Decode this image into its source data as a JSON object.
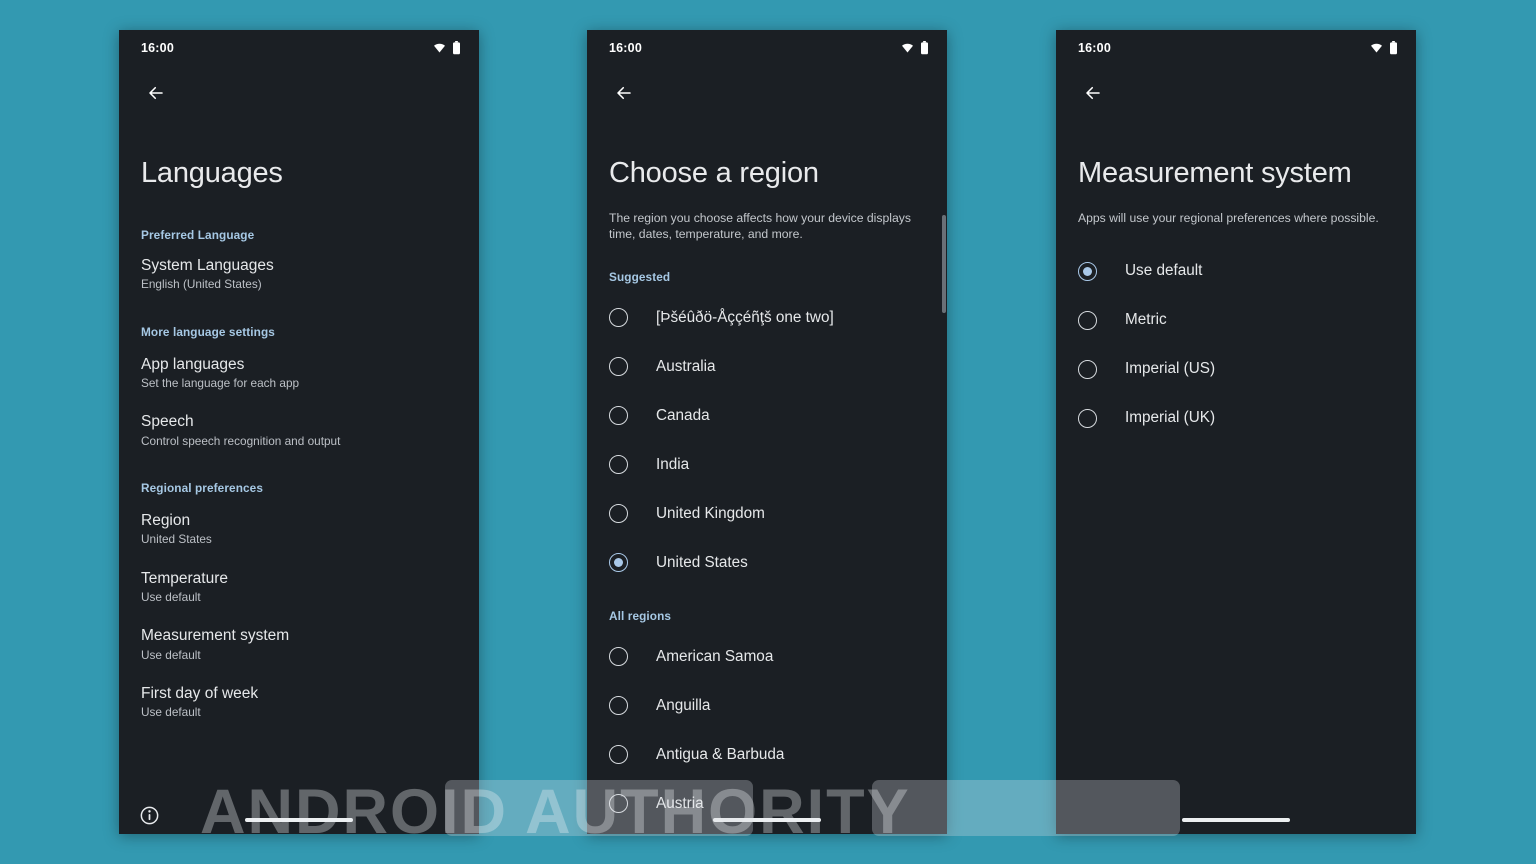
{
  "background_color": "#3399b1",
  "accent_color": "#a9c8e8",
  "section_header_color": "#a6c8e4",
  "status_bar": {
    "time": "16:00",
    "wifi_icon": "wifi-icon",
    "battery_icon": "battery-icon"
  },
  "watermark": {
    "text": "ANDROID AUTHORITY"
  },
  "phones": [
    {
      "id": "languages",
      "title": "Languages",
      "back_icon": "back-arrow-icon",
      "info_icon": "info-icon",
      "sections": [
        {
          "header": "Preferred Language",
          "items": [
            {
              "title": "System Languages",
              "subtitle": "English (United States)"
            }
          ]
        },
        {
          "header": "More language settings",
          "items": [
            {
              "title": "App languages",
              "subtitle": "Set the language for each app"
            },
            {
              "title": "Speech",
              "subtitle": "Control speech recognition and output"
            }
          ]
        },
        {
          "header": "Regional preferences",
          "items": [
            {
              "title": "Region",
              "subtitle": "United States"
            },
            {
              "title": "Temperature",
              "subtitle": "Use default"
            },
            {
              "title": "Measurement system",
              "subtitle": "Use default"
            },
            {
              "title": "First day of week",
              "subtitle": "Use default"
            }
          ]
        }
      ]
    },
    {
      "id": "choose-a-region",
      "title": "Choose a region",
      "back_icon": "back-arrow-icon",
      "description": "The region you choose affects how your device displays time, dates, temperature, and more.",
      "groups": [
        {
          "header": "Suggested",
          "options": [
            {
              "label": "[Þšéûðö-Åççéñţš one two]",
              "selected": false
            },
            {
              "label": "Australia",
              "selected": false
            },
            {
              "label": "Canada",
              "selected": false
            },
            {
              "label": "India",
              "selected": false
            },
            {
              "label": "United Kingdom",
              "selected": false
            },
            {
              "label": "United States",
              "selected": true
            }
          ]
        },
        {
          "header": "All regions",
          "options": [
            {
              "label": "American Samoa",
              "selected": false
            },
            {
              "label": "Anguilla",
              "selected": false
            },
            {
              "label": "Antigua & Barbuda",
              "selected": false
            },
            {
              "label": "Austria",
              "selected": false
            }
          ]
        }
      ]
    },
    {
      "id": "measurement-system",
      "title": "Measurement system",
      "back_icon": "back-arrow-icon",
      "description": "Apps will use your regional preferences where possible.",
      "groups": [
        {
          "header": "",
          "options": [
            {
              "label": "Use default",
              "selected": true
            },
            {
              "label": "Metric",
              "selected": false
            },
            {
              "label": "Imperial (US)",
              "selected": false
            },
            {
              "label": "Imperial (UK)",
              "selected": false
            }
          ]
        }
      ]
    }
  ]
}
